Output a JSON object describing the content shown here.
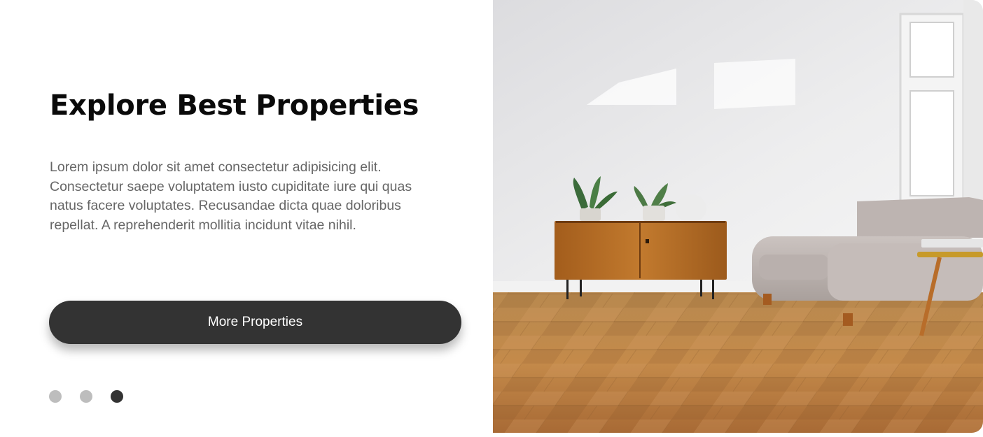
{
  "hero": {
    "title": "Explore Best Properties",
    "description": "Lorem ipsum dolor sit amet consectetur adipisicing elit. Consectetur saepe voluptatem iusto cupiditate iure qui quas natus facere voluptates. Recusandae dicta quae doloribus repellat. A reprehenderit mollitia incidunt vitae nihil.",
    "cta_label": "More Properties"
  },
  "carousel": {
    "slide_count": 3,
    "active_index": 2
  },
  "photo": {
    "subject": "living-room-interior"
  },
  "colors": {
    "text_heading": "#0a0a0a",
    "text_body": "#666666",
    "button_bg": "#333333",
    "dot_inactive": "#bdbdbd",
    "dot_active": "#333333"
  }
}
